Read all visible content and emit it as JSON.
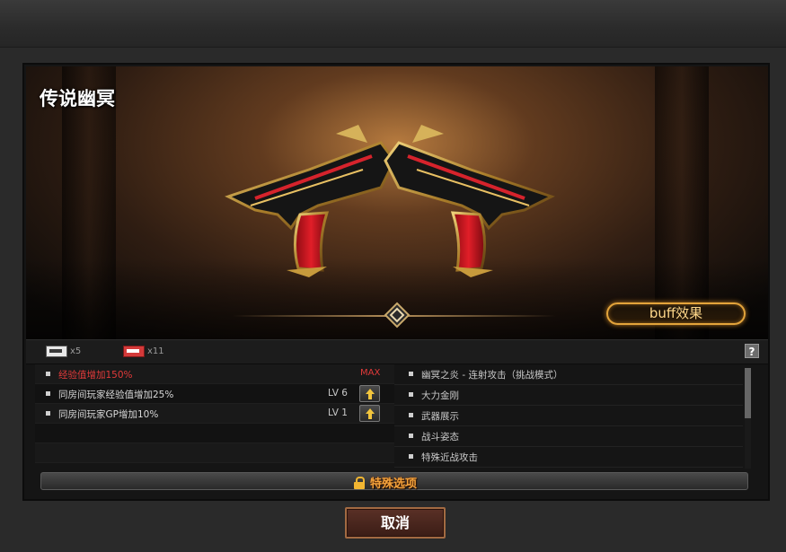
{
  "item": {
    "name": "传说幽冥"
  },
  "buff_button": {
    "label": "buff效果"
  },
  "counts": [
    {
      "label": "x5"
    },
    {
      "label": "x11"
    }
  ],
  "help": {
    "label": "?"
  },
  "left_options": [
    {
      "text": "经验值增加150%",
      "level": "",
      "max": "MAX",
      "color": "#e13a3a",
      "upgradable": false
    },
    {
      "text": "同房间玩家经验值增加25%",
      "level": "LV 6",
      "max": "",
      "upgradable": true
    },
    {
      "text": "同房间玩家GP增加10%",
      "level": "LV 1",
      "max": "",
      "upgradable": true
    }
  ],
  "right_features": [
    "幽冥之炎 - 连射攻击（挑战模式）",
    "大力金刚",
    "武器展示",
    "战斗姿态",
    "特殊近战攻击"
  ],
  "special_options": {
    "label": "特殊选项"
  },
  "cancel": {
    "label": "取消"
  },
  "colors": {
    "accent": "#e3a43b",
    "warning": "#e13a3a",
    "special": "#f2a23c"
  }
}
